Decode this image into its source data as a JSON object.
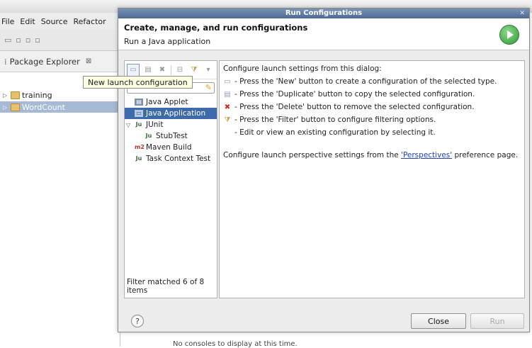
{
  "bg": {
    "menu": [
      "File",
      "Edit",
      "Source",
      "Refactor"
    ],
    "package_explorer": {
      "title": "Package Explorer",
      "close": "⊠"
    },
    "tree": [
      {
        "label": "training"
      },
      {
        "label": "WordCount"
      }
    ],
    "status": "No consoles to display at this time."
  },
  "tooltip": "New launch configuration",
  "dialog": {
    "window_title": "Run Configurations",
    "heading": "Create, manage, and run configurations",
    "subheading": "Run a Java application",
    "configs": {
      "java_applet": "Java Applet",
      "java_application": "Java Application",
      "junit": "JUnit",
      "stubtest": "StubTest",
      "maven_build": "Maven Build",
      "task_context_test": "Task Context Test"
    },
    "filter_status": "Filter matched 6 of 8 items",
    "help": {
      "intro": "Configure launch settings from this dialog:",
      "new": "- Press the 'New' button to create a configuration of the selected type.",
      "duplicate": "- Press the 'Duplicate' button to copy the selected configuration.",
      "delete": "- Press the 'Delete' button to remove the selected configuration.",
      "filter": "- Press the 'Filter' button to configure filtering options.",
      "edit": "- Edit or view an existing configuration by selecting it.",
      "persp_before": "Configure launch perspective settings from the ",
      "persp_link": "'Perspectives'",
      "persp_after": " preference page."
    },
    "buttons": {
      "help": "?",
      "close": "Close",
      "run": "Run"
    }
  }
}
